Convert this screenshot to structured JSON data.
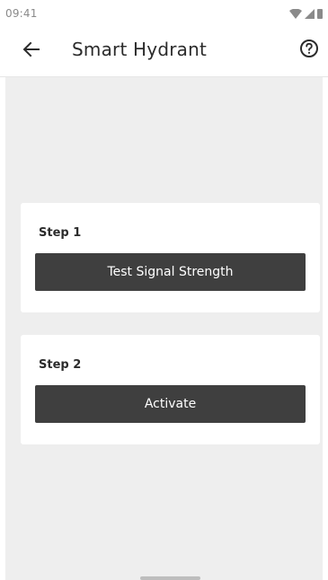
{
  "status_bar": {
    "time": "09:41",
    "icons": [
      "wifi-icon",
      "signal-icon",
      "battery-icon"
    ]
  },
  "app_bar": {
    "title": "Smart Hydrant",
    "back_icon": "arrow-left-icon",
    "help_icon": "help-circle-icon"
  },
  "steps": [
    {
      "label": "Step 1",
      "button_label": "Test Signal Strength"
    },
    {
      "label": "Step 2",
      "button_label": "Activate"
    }
  ],
  "colors": {
    "background": "#eeeeee",
    "card": "#ffffff",
    "button": "#3f3f3f",
    "button_text": "#ffffff"
  }
}
